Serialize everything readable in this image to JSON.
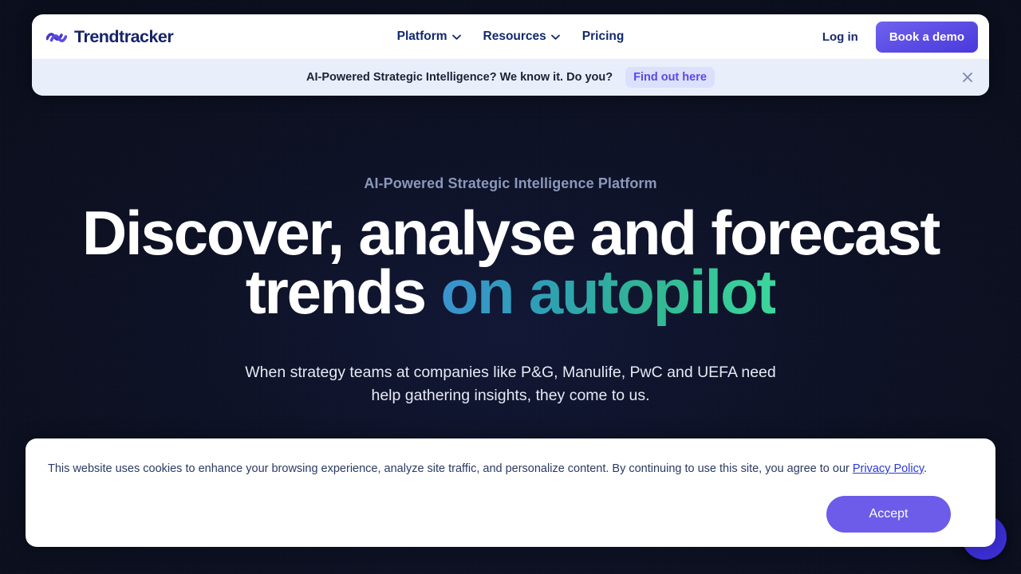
{
  "brand": {
    "name": "Trendtracker",
    "logo_icon": "wave-logo-icon",
    "logo_color": "#4338ca",
    "text_color": "#15246b"
  },
  "header": {
    "nav": [
      {
        "label": "Platform",
        "has_dropdown": true,
        "icon": "chevron-down-icon"
      },
      {
        "label": "Resources",
        "has_dropdown": true,
        "icon": "chevron-down-icon"
      },
      {
        "label": "Pricing",
        "has_dropdown": false,
        "icon": ""
      }
    ],
    "login_label": "Log in",
    "demo_label": "Book a demo",
    "demo_color": "#5a4be3"
  },
  "announcement": {
    "text": "AI-Powered Strategic Intelligence? We know it. Do you?",
    "cta_label": "Find out here",
    "cta_color": "#5b4ae4",
    "background": "#e9eefb",
    "close_icon": "close-icon"
  },
  "hero": {
    "eyebrow": "AI-Powered Strategic Intelligence Platform",
    "headline_line1": "Discover, analyse and forecast",
    "headline_line2_plain": "trends",
    "headline_line2_gradient": "on autopilot",
    "gradient_from": "#3a93cf",
    "gradient_to": "#3bd79c",
    "subhead_line1": "When strategy teams at companies like P&G, Manulife, PwC and UEFA",
    "subhead_line2": "need help gathering insights, they come to us."
  },
  "cookie": {
    "text_before_link": "This website uses cookies to enhance your browsing experience, analyze site traffic, and personalize content. By continuing to use this site, you agree to our ",
    "link_label": "Privacy Policy",
    "text_after_link": ".",
    "accept_label": "Accept",
    "accept_color": "#6c5ce9"
  },
  "chat": {
    "icon": "chat-bubble-icon",
    "color": "#3b2fd4"
  }
}
